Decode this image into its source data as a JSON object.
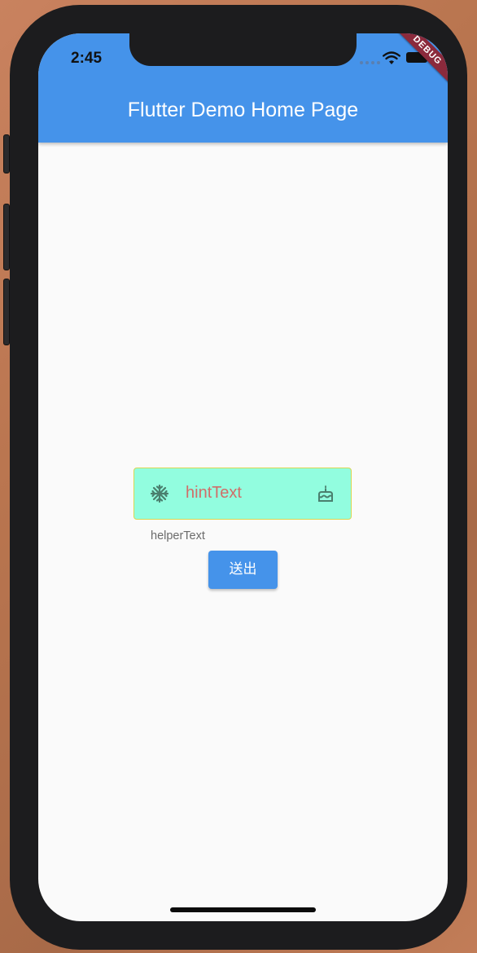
{
  "status_bar": {
    "time": "2:45",
    "debug_label": "DEBUG"
  },
  "app_bar": {
    "title": "Flutter Demo Home Page",
    "color": "#4593ea"
  },
  "text_field": {
    "hint": "hintText",
    "helper": "helperText",
    "prefix_icon": "snowflake-icon",
    "suffix_icon": "cake-icon",
    "fill_color": "#92fddf",
    "border_color": "#d9d651",
    "hint_color": "#d06e69"
  },
  "send_button": {
    "label": "送出"
  }
}
